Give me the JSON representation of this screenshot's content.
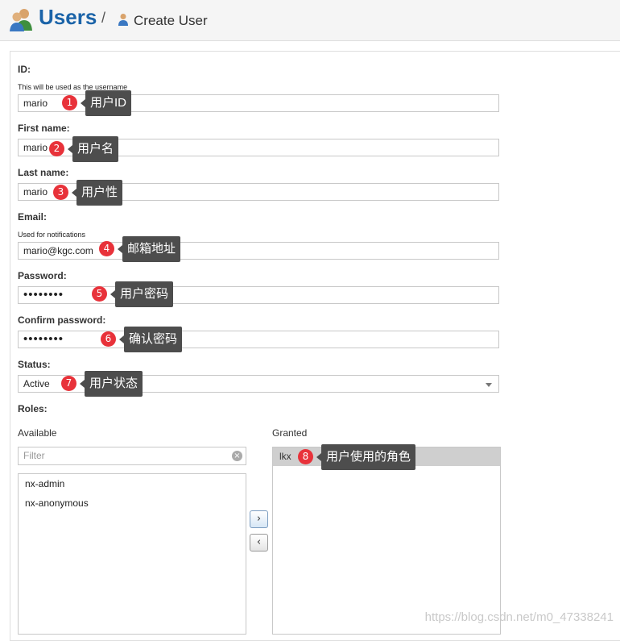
{
  "header": {
    "title": "Users",
    "separator": "/",
    "crumb": "Create User"
  },
  "form": {
    "id": {
      "label": "ID:",
      "help": "This will be used as the username",
      "value": "mario"
    },
    "first_name": {
      "label": "First name:",
      "value": "mario"
    },
    "last_name": {
      "label": "Last name:",
      "value": "mario"
    },
    "email": {
      "label": "Email:",
      "help": "Used for notifications",
      "value": "mario@kgc.com"
    },
    "password": {
      "label": "Password:",
      "value": "••••••••"
    },
    "confirm_password": {
      "label": "Confirm password:",
      "value": "••••••••"
    },
    "status": {
      "label": "Status:",
      "value": "Active"
    },
    "roles": {
      "label": "Roles:",
      "available_title": "Available",
      "granted_title": "Granted",
      "filter_placeholder": "Filter",
      "available": [
        "nx-admin",
        "nx-anonymous"
      ],
      "granted": [
        "lkx"
      ],
      "move_right": "›",
      "move_left": "‹",
      "clear": "×"
    }
  },
  "annotations": [
    {
      "num": "1",
      "text": "用户ID"
    },
    {
      "num": "2",
      "text": "用户名"
    },
    {
      "num": "3",
      "text": "用户性"
    },
    {
      "num": "4",
      "text": "邮箱地址"
    },
    {
      "num": "5",
      "text": "用户密码"
    },
    {
      "num": "6",
      "text": "确认密码"
    },
    {
      "num": "7",
      "text": "用户状态"
    },
    {
      "num": "8",
      "text": "用户使用的角色"
    }
  ],
  "watermark": "https://blog.csdn.net/m0_47338241",
  "colors": {
    "brand": "#1a63a8",
    "badge": "#e8323a",
    "tooltip": "#4d4d4d"
  }
}
